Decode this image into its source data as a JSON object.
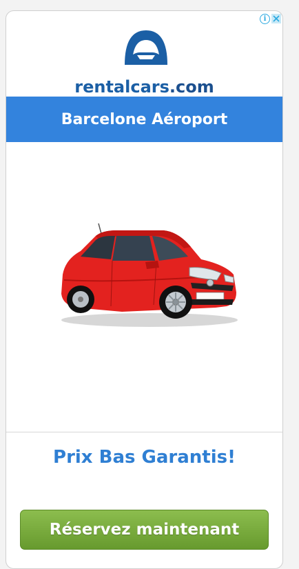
{
  "ad": {
    "brand_name": "rentalcars",
    "brand_domain": ".com",
    "location": "Barcelone Aéroport",
    "tagline": "Prix Bas Garantis!",
    "cta_label": "Réservez maintenant"
  },
  "colors": {
    "brand_blue": "#1b5fa5",
    "location_bar": "#3383dd",
    "tagline_blue": "#2f7fd3",
    "cta_green": "#7aad3f",
    "car_red": "#e3221f"
  },
  "icons": {
    "adchoices_info": "info-icon",
    "adchoices_close": "close-icon",
    "logo": "car-arch-logo-icon",
    "car": "red-hatchback-car-image"
  }
}
